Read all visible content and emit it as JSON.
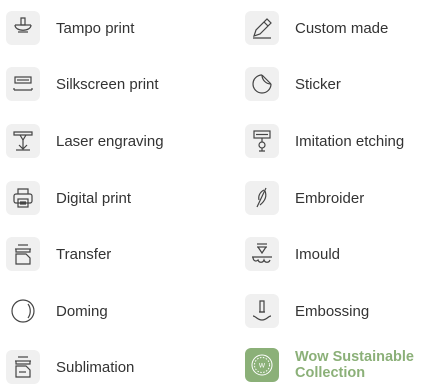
{
  "left_column": [
    {
      "label": "Tampo print",
      "icon": "tampo-stamp-icon"
    },
    {
      "label": "Silkscreen print",
      "icon": "silkscreen-icon"
    },
    {
      "label": "Laser engraving",
      "icon": "laser-engraving-icon"
    },
    {
      "label": "Digital print",
      "icon": "printer-icon"
    },
    {
      "label": "Transfer",
      "icon": "transfer-icon"
    },
    {
      "label": "Doming",
      "icon": "doming-icon"
    },
    {
      "label": "Sublimation",
      "icon": "sublimation-icon"
    }
  ],
  "right_column": [
    {
      "label": "Custom made",
      "icon": "pencil-icon"
    },
    {
      "label": "Sticker",
      "icon": "sticker-icon"
    },
    {
      "label": "Imitation etching",
      "icon": "imitation-etching-icon"
    },
    {
      "label": "Embroider",
      "icon": "needle-icon"
    },
    {
      "label": "Imould",
      "icon": "imould-icon"
    },
    {
      "label": "Embossing",
      "icon": "embossing-icon"
    },
    {
      "label": "Wow Sustainable Collection",
      "icon": "wow-sustainable-logo"
    }
  ],
  "colors": {
    "icon_bg": "#f0f0f0",
    "icon_stroke": "#444444",
    "text": "#333333",
    "accent_green": "#8bb078"
  }
}
